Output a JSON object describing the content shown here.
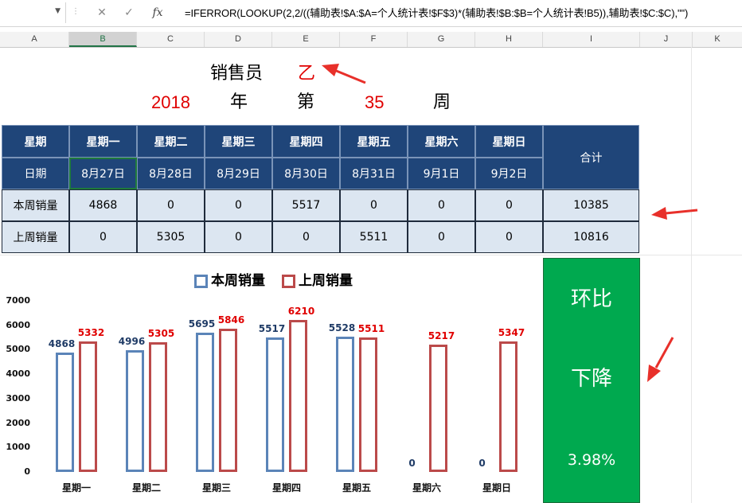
{
  "formula_bar": {
    "cancel_icon": "close-icon",
    "enter_icon": "check-icon",
    "function_label": "fx",
    "formula": "=IFERROR(LOOKUP(2,2/((辅助表!$A:$A=个人统计表!$F$3)*(辅助表!$B:$B=个人统计表!B5)),辅助表!$C:$C),\"\")"
  },
  "columns": [
    "A",
    "B",
    "C",
    "D",
    "E",
    "F",
    "G",
    "H",
    "I",
    "J",
    "K"
  ],
  "header": {
    "salesperson_label": "销售员",
    "salesperson_value": "乙",
    "year": "2018",
    "year_label": "年",
    "week_prefix": "第",
    "week": "35",
    "week_suffix": "周"
  },
  "table": {
    "row_labels": [
      "星期",
      "日期",
      "本周销量",
      "上周销量"
    ],
    "weekdays": [
      "星期一",
      "星期二",
      "星期三",
      "星期四",
      "星期五",
      "星期六",
      "星期日"
    ],
    "dates": [
      "8月27日",
      "8月28日",
      "8月29日",
      "8月30日",
      "8月31日",
      "9月1日",
      "9月2日"
    ],
    "total_label": "合计",
    "this_week": [
      "4868",
      "0",
      "0",
      "5517",
      "0",
      "0",
      "0"
    ],
    "this_week_total": "10385",
    "last_week": [
      "0",
      "5305",
      "0",
      "0",
      "5511",
      "0",
      "0"
    ],
    "last_week_total": "10816"
  },
  "chart_data": {
    "type": "bar",
    "categories": [
      "星期一",
      "星期二",
      "星期三",
      "星期四",
      "星期五",
      "星期六",
      "星期日"
    ],
    "series": [
      {
        "name": "本周销量",
        "values": [
          4868,
          4996,
          5695,
          5517,
          5528,
          0,
          0
        ],
        "color": "#5b84b8"
      },
      {
        "name": "上周销量",
        "values": [
          5332,
          5305,
          5846,
          6210,
          5511,
          5217,
          5347
        ],
        "color": "#bb4a4a"
      }
    ],
    "ylim": [
      0,
      7000
    ],
    "yticks": [
      "0",
      "1000",
      "2000",
      "3000",
      "4000",
      "5000",
      "6000",
      "7000"
    ],
    "legend": "top-center",
    "grid": false
  },
  "summary": {
    "title": "环比",
    "direction": "下降",
    "percent": "3.98%",
    "color": "#00a94f"
  },
  "colors": {
    "header_bg": "#1f4579",
    "cell_bg": "#dce6f1",
    "accent_red": "#e00000",
    "arrow": "#e8302a"
  }
}
